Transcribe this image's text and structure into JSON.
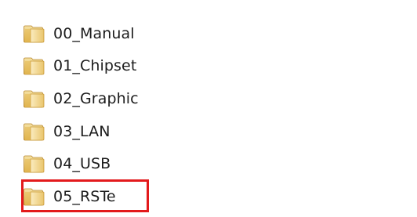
{
  "folder_list": {
    "items": [
      {
        "name": "00_Manual",
        "icon": "folder-icon"
      },
      {
        "name": "01_Chipset",
        "icon": "folder-icon"
      },
      {
        "name": "02_Graphic",
        "icon": "folder-icon"
      },
      {
        "name": "03_LAN",
        "icon": "folder-icon"
      },
      {
        "name": "04_USB",
        "icon": "folder-icon"
      },
      {
        "name": "05_RSTe",
        "icon": "folder-icon"
      }
    ],
    "highlighted_item": "05_RSTe"
  },
  "colors": {
    "highlight_border": "#e31a1c",
    "folder_body": "#e8c36a",
    "folder_front": "#f3d98e",
    "text": "#1c1c1c"
  }
}
